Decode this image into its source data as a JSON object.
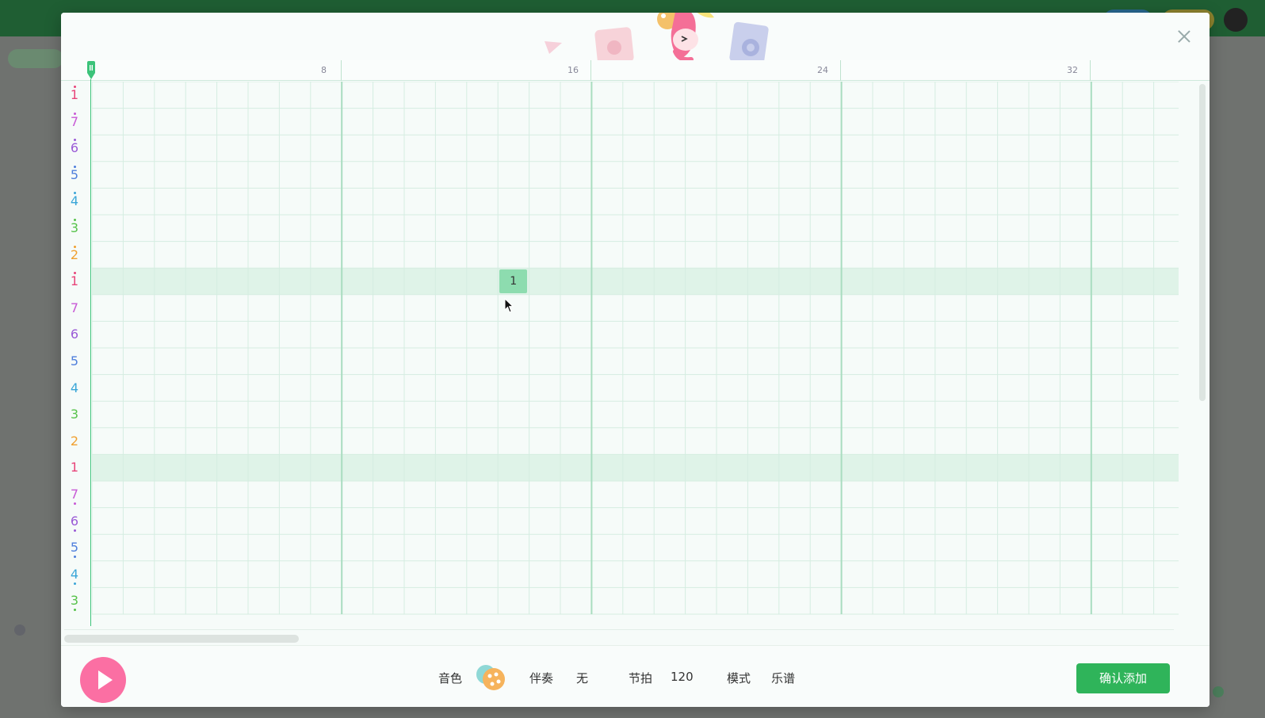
{
  "modal": {
    "close_label": "×"
  },
  "ruler": {
    "marks": [
      "8",
      "16",
      "24",
      "32"
    ]
  },
  "note_rows": [
    {
      "label": "1",
      "dots_above": 1,
      "dots_below": 0,
      "color": "#e8457a"
    },
    {
      "label": "7",
      "dots_above": 1,
      "dots_below": 0,
      "color": "#c85ad6"
    },
    {
      "label": "6",
      "dots_above": 1,
      "dots_below": 0,
      "color": "#9a5ad6"
    },
    {
      "label": "5",
      "dots_above": 1,
      "dots_below": 0,
      "color": "#4f7fdc"
    },
    {
      "label": "4",
      "dots_above": 1,
      "dots_below": 0,
      "color": "#3aa6d8"
    },
    {
      "label": "3",
      "dots_above": 1,
      "dots_below": 0,
      "color": "#56c24a"
    },
    {
      "label": "2",
      "dots_above": 1,
      "dots_below": 0,
      "color": "#f0a030"
    },
    {
      "label": "1",
      "dots_above": 1,
      "dots_below": 0,
      "color": "#e8457a"
    },
    {
      "label": "7",
      "dots_above": 0,
      "dots_below": 0,
      "color": "#c85ad6"
    },
    {
      "label": "6",
      "dots_above": 0,
      "dots_below": 0,
      "color": "#9a5ad6"
    },
    {
      "label": "5",
      "dots_above": 0,
      "dots_below": 0,
      "color": "#4f7fdc"
    },
    {
      "label": "4",
      "dots_above": 0,
      "dots_below": 0,
      "color": "#3aa6d8"
    },
    {
      "label": "3",
      "dots_above": 0,
      "dots_below": 0,
      "color": "#56c24a"
    },
    {
      "label": "2",
      "dots_above": 0,
      "dots_below": 0,
      "color": "#f0a030"
    },
    {
      "label": "1",
      "dots_above": 0,
      "dots_below": 0,
      "color": "#e8457a"
    },
    {
      "label": "7",
      "dots_above": 0,
      "dots_below": 1,
      "color": "#c85ad6"
    },
    {
      "label": "6",
      "dots_above": 0,
      "dots_below": 1,
      "color": "#9a5ad6"
    },
    {
      "label": "5",
      "dots_above": 0,
      "dots_below": 1,
      "color": "#4f7fdc"
    },
    {
      "label": "4",
      "dots_above": 0,
      "dots_below": 1,
      "color": "#3aa6d8"
    },
    {
      "label": "3",
      "dots_above": 0,
      "dots_below": 1,
      "color": "#56c24a"
    }
  ],
  "highlighted_rows": [
    7,
    14
  ],
  "placed_notes": [
    {
      "label": "1",
      "row": 7,
      "step": 13
    }
  ],
  "grid": {
    "steps": 35,
    "bar_every": 8
  },
  "controls": {
    "timbre_label": "音色",
    "accompaniment_label": "伴奏",
    "accompaniment_value": "无",
    "tempo_label": "节拍",
    "tempo_value": "120",
    "mode_label": "模式",
    "mode_value": "乐谱",
    "confirm_label": "确认添加"
  },
  "colors": {
    "accent_green": "#2fb45a",
    "play_pink": "#fb6fa3",
    "row_highlight": "#dff3e8",
    "grid_line": "#d5ede1",
    "bar_line": "#a9ddc0"
  }
}
